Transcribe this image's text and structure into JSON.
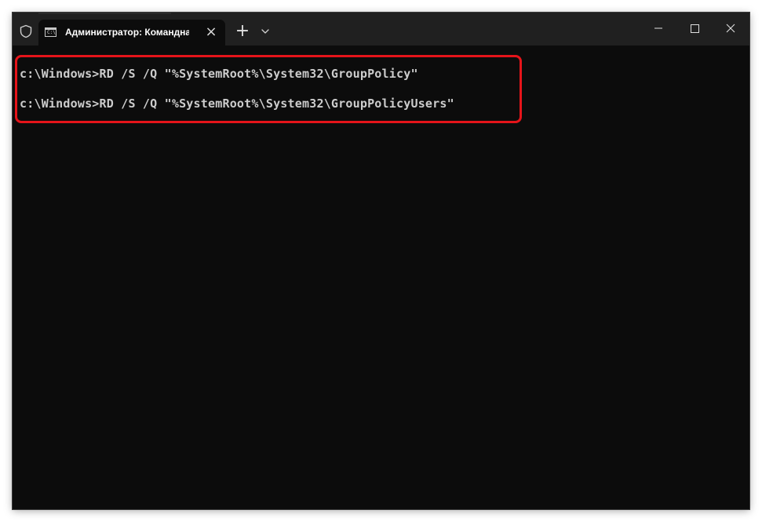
{
  "titlebar": {
    "tab_title": "Администратор: Командная строка",
    "tab_icon_text": "C:\\",
    "new_tab_symbol": "+",
    "close_tab_symbol": "×"
  },
  "terminal": {
    "lines": [
      "c:\\Windows>RD /S /Q \"%SystemRoot%\\System32\\GroupPolicy\"",
      "c:\\Windows>RD /S /Q \"%SystemRoot%\\System32\\GroupPolicyUsers\""
    ]
  },
  "colors": {
    "titlebar_bg": "#202020",
    "terminal_bg": "#0c0c0c",
    "terminal_text": "#cccccc",
    "highlight": "#e5141a"
  },
  "icons": [
    "shield-icon",
    "cmd-icon",
    "close-icon",
    "plus-icon",
    "chevron-down-icon",
    "minimize-icon",
    "maximize-icon"
  ]
}
